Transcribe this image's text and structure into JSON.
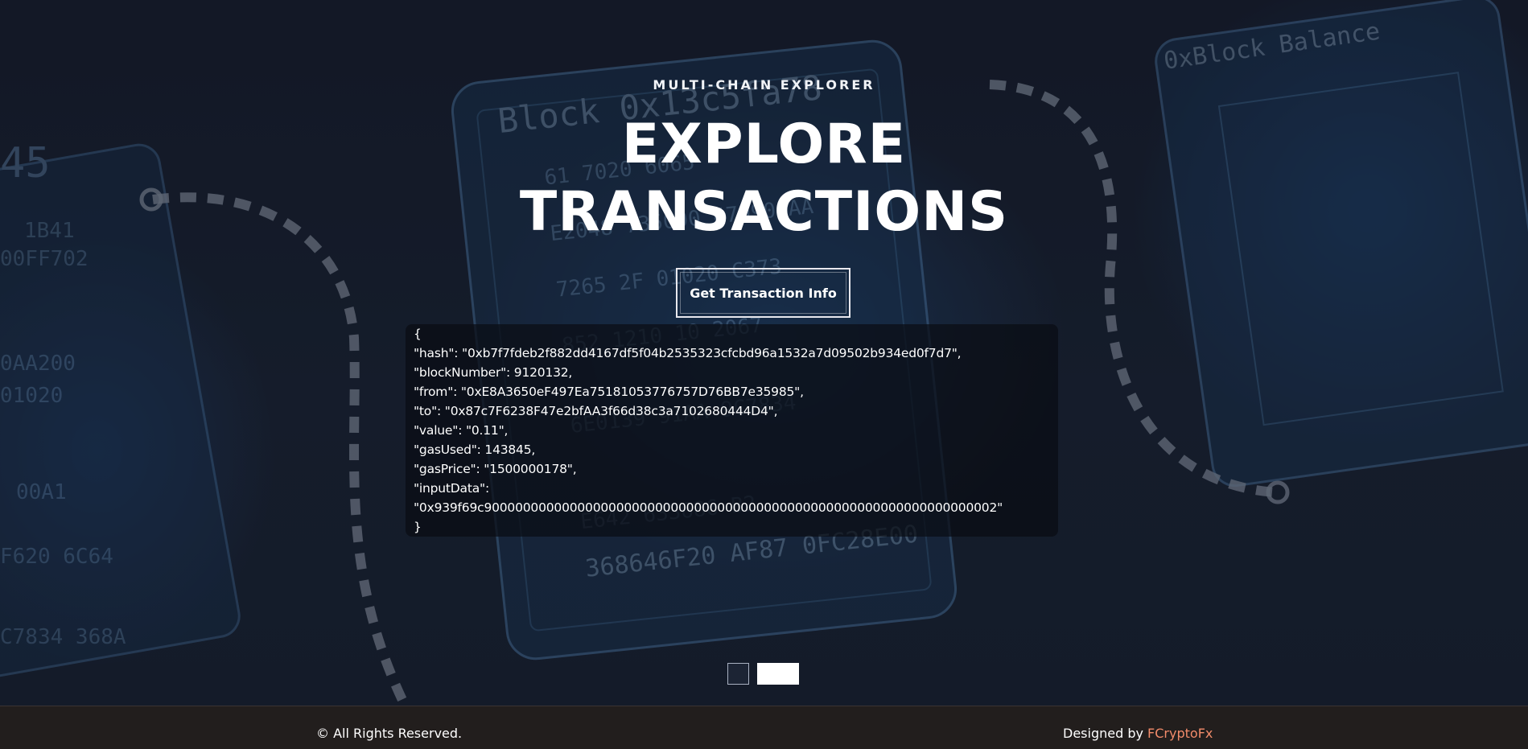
{
  "hero": {
    "eyebrow": "MULTI-CHAIN EXPLORER",
    "title_line1": "EXPLORE",
    "title_line2": "TRANSACTIONS",
    "cta_label": "Get Transaction Info"
  },
  "result": {
    "lines": [
      "{",
      "\"hash\": \"0xb7f7fdeb2f882dd4167df5f04b2535323cfcbd96a1532a7d09502b934ed0f7d7\",",
      "\"blockNumber\": 9120132,",
      "\"from\": \"0xE8A3650eF497Ea75181053776757D76BB7e35985\",",
      "\"to\": \"0x87c7F6238F47e2bfAA3f66d38c3a7102680444D4\",",
      "\"value\": \"0.11\",",
      "\"gasUsed\": 143845,",
      "\"gasPrice\": \"1500000178\",",
      "\"inputData\":",
      "\"0x939f69c900000000000000000000000000000000000000000000000000000000000000002\"",
      "}"
    ]
  },
  "pager": {
    "active_index": 1,
    "count": 2
  },
  "footer": {
    "copyright": "© All Rights Reserved.",
    "designed_prefix": "Designed by ",
    "designed_link": "FCryptoFx"
  },
  "colors": {
    "footer_bg": "#221e1d",
    "link_accent": "#f28b6a",
    "hero_bg": "#1b2333"
  }
}
